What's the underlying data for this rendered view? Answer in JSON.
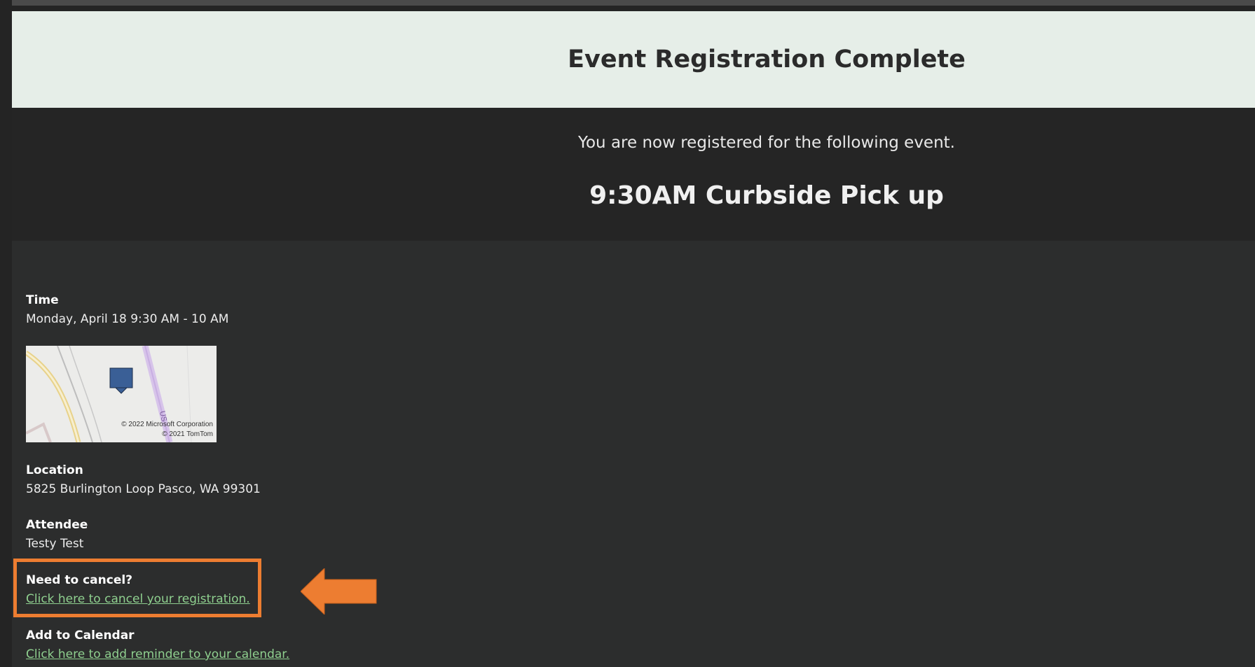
{
  "header": {
    "title": "Event Registration Complete"
  },
  "intro": {
    "message": "You are now registered for the following event.",
    "event_title": "9:30AM Curbside Pick up"
  },
  "details": {
    "time_label": "Time",
    "time_value": "Monday, April 18 9:30 AM - 10 AM",
    "map": {
      "copyright_line1": "© 2022 Microsoft Corporation",
      "copyright_line2": "© 2021 TomTom",
      "road_label": "US"
    },
    "location_label": "Location",
    "location_value": "5825 Burlington Loop Pasco, WA 99301",
    "attendee_label": "Attendee",
    "attendee_value": "Testy Test",
    "cancel_label": "Need to cancel?",
    "cancel_link": "Click here to cancel your registration.",
    "calendar_label": "Add to Calendar",
    "calendar_link": "Click here to add reminder to your calendar."
  },
  "colors": {
    "header_bg": "#e6eee8",
    "page_bg": "#2c2d2d",
    "link": "#8fd08f",
    "highlight": "#ed7d31",
    "map_pin": "#3a5f96"
  }
}
